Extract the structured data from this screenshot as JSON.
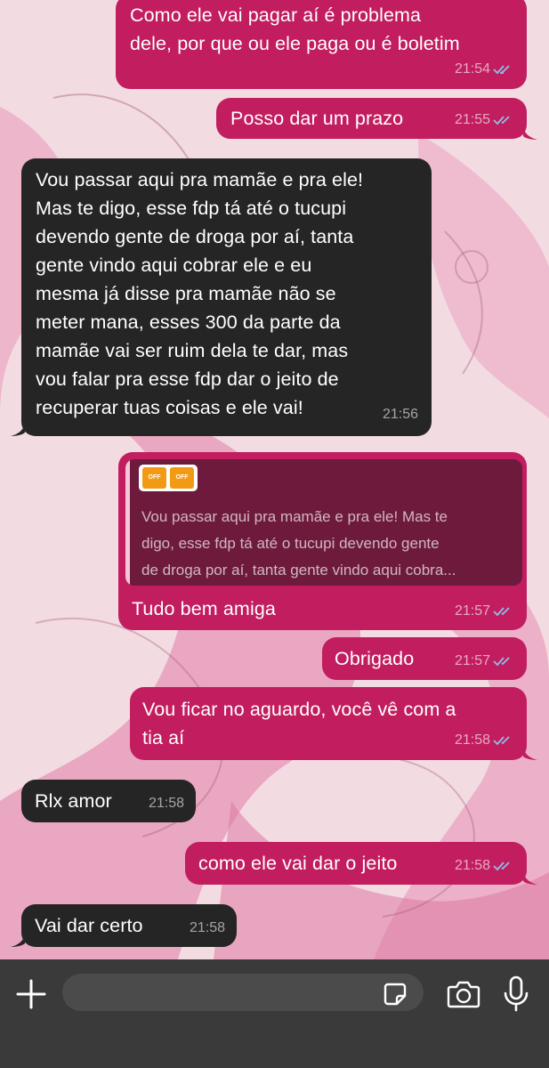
{
  "colors": {
    "outgoing_bubble": "#c21d5f",
    "incoming_bubble": "#252525",
    "wallpaper_base": "#f3dbe2",
    "read_ticks": "#8fbfe8",
    "input_bar": "#3a3a3a"
  },
  "messages": [
    {
      "direction": "outgoing",
      "lines": [
        "Como ele vai pagar aí é problema",
        "dele, por que ou ele paga ou é boletim"
      ],
      "time": "21:54",
      "status": "read"
    },
    {
      "direction": "outgoing",
      "lines": [
        "Posso dar um prazo"
      ],
      "time": "21:55",
      "status": "read"
    },
    {
      "direction": "incoming",
      "lines": [
        "Vou passar aqui pra mamãe e pra ele!",
        "Mas te digo, esse fdp tá até o tucupi",
        "devendo gente de droga por aí, tanta",
        "gente vindo aqui cobrar ele e eu",
        "mesma já disse pra mamãe não se",
        "meter mana, esses 300 da parte da",
        "mamãe vai ser ruim dela te dar, mas",
        "vou falar pra esse fdp dar o jeito de",
        "recuperar tuas coisas e ele vai!"
      ],
      "time": "21:56"
    },
    {
      "direction": "outgoing",
      "quote": {
        "sticker_labels": [
          "OFF",
          "OFF"
        ],
        "lines": [
          "Vou passar aqui pra mamãe e pra ele! Mas te",
          "digo, esse fdp tá até o tucupi devendo gente",
          "de droga por aí, tanta gente vindo aqui cobra..."
        ]
      },
      "lines": [
        "Tudo bem amiga"
      ],
      "time": "21:57",
      "status": "read"
    },
    {
      "direction": "outgoing",
      "lines": [
        "Obrigado"
      ],
      "time": "21:57",
      "status": "read"
    },
    {
      "direction": "outgoing",
      "lines": [
        "Vou ficar no aguardo, você vê com a",
        "tia aí"
      ],
      "time": "21:58",
      "status": "read"
    },
    {
      "direction": "incoming",
      "lines": [
        "Rlx amor"
      ],
      "time": "21:58"
    },
    {
      "direction": "outgoing",
      "lines": [
        "como ele vai dar o jeito"
      ],
      "time": "21:58",
      "status": "read"
    },
    {
      "direction": "incoming",
      "lines": [
        "Vai dar certo"
      ],
      "time": "21:58"
    }
  ],
  "input_bar": {
    "placeholder": "",
    "icons": [
      "plus-icon",
      "sticker-icon",
      "camera-icon",
      "microphone-icon"
    ]
  }
}
